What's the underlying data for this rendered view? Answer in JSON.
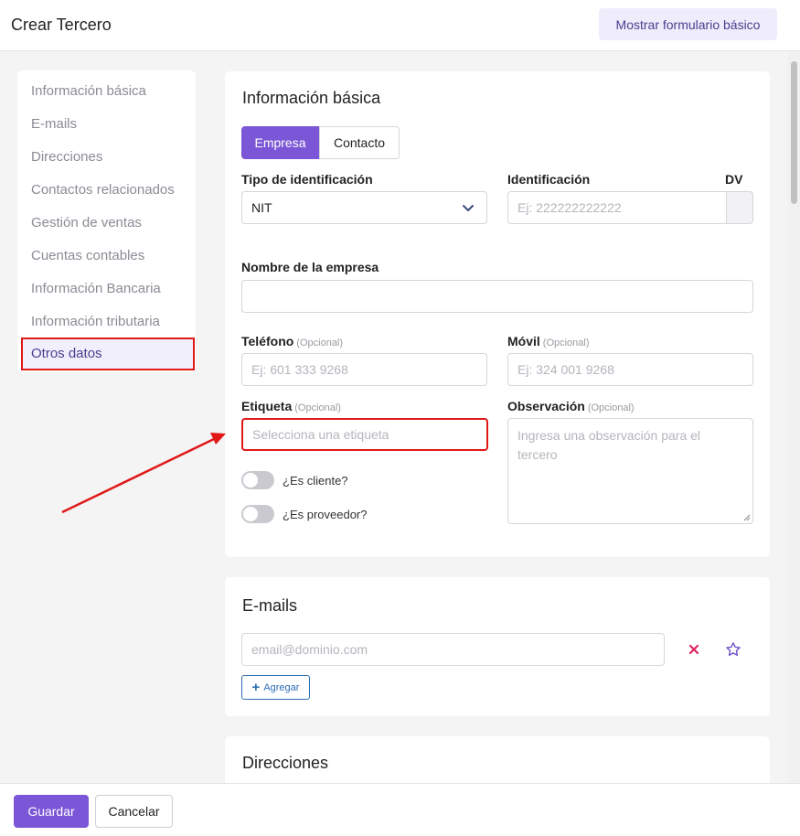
{
  "header": {
    "title": "Crear Tercero",
    "basic_form_button": "Mostrar formulario básico"
  },
  "sidebar": {
    "items": [
      {
        "label": "Información básica"
      },
      {
        "label": "E-mails"
      },
      {
        "label": "Direcciones"
      },
      {
        "label": "Contactos relacionados"
      },
      {
        "label": "Gestión de ventas"
      },
      {
        "label": "Cuentas contables"
      },
      {
        "label": "Información Bancaria"
      },
      {
        "label": "Información tributaria"
      },
      {
        "label": "Otros datos"
      }
    ],
    "active_index": 8
  },
  "basic_info": {
    "title": "Información básica",
    "type_tabs": [
      "Empresa",
      "Contacto"
    ],
    "id_type": {
      "label": "Tipo de identificación",
      "value": "NIT"
    },
    "identification": {
      "label": "Identificación",
      "placeholder": "Ej: 222222222222"
    },
    "dv": {
      "label": "DV"
    },
    "company_name": {
      "label": "Nombre de la empresa",
      "value": ""
    },
    "phone": {
      "label": "Teléfono",
      "optional": "(Opcional)",
      "placeholder": "Ej: 601 333 9268"
    },
    "mobile": {
      "label": "Móvil",
      "optional": "(Opcional)",
      "placeholder": "Ej: 324 001 9268"
    },
    "tag": {
      "label": "Etiqueta",
      "optional": "(Opcional)",
      "placeholder": "Selecciona una etiqueta"
    },
    "observation": {
      "label": "Observación",
      "optional": "(Opcional)",
      "placeholder": "Ingresa una observación para el tercero"
    },
    "is_client": {
      "label": "¿Es cliente?",
      "on": false
    },
    "is_supplier": {
      "label": "¿Es proveedor?",
      "on": false
    }
  },
  "emails": {
    "title": "E-mails",
    "placeholder": "email@dominio.com",
    "add_label": "Agregar"
  },
  "addresses": {
    "title": "Direcciones"
  },
  "footer": {
    "save_label": "Guardar",
    "cancel_label": "Cancelar"
  },
  "colors": {
    "accent": "#7b56d6",
    "highlight": "#e01818",
    "remove_icon": "#e0245e",
    "star_icon": "#6b4fc6",
    "link": "#2f6db5"
  }
}
